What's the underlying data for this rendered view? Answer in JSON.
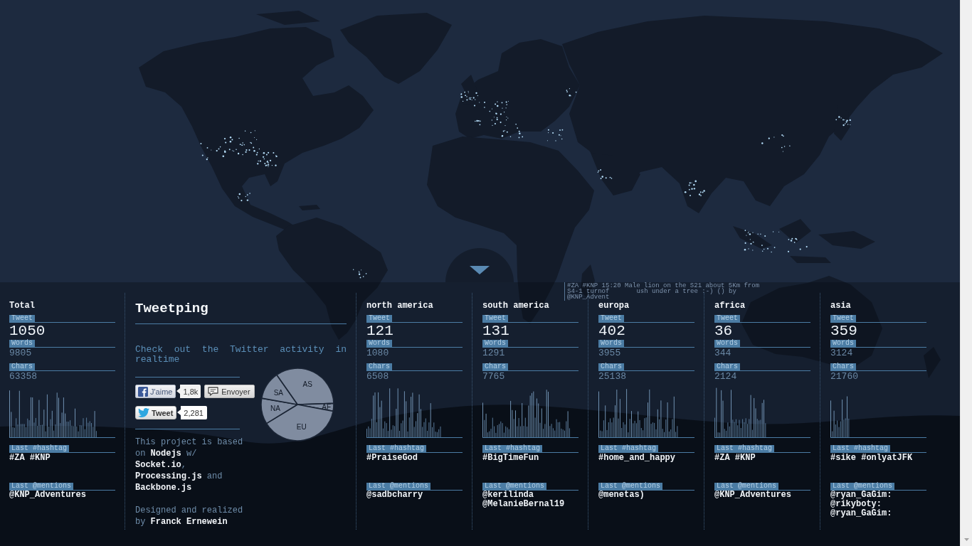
{
  "total": {
    "title": "Total",
    "stats": [
      {
        "kind": "primary",
        "label": "Tweet",
        "value": "1050"
      },
      {
        "kind": "secondary",
        "label": "Words",
        "value": "9805"
      },
      {
        "kind": "secondary",
        "label": "Chars",
        "value": "63358"
      }
    ],
    "hashtag": {
      "label": "Last #hashtag",
      "value": "#ZA #KNP"
    },
    "mentions": {
      "label": "Last @mentions",
      "value": "@KNP_Adventures"
    }
  },
  "about": {
    "title": "Tweetping",
    "tagline": "Check out the Twitter activity in realtime",
    "social_rows": [
      {
        "buttons": [
          {
            "kind": "like",
            "label": "J'aime",
            "count": "1,8k"
          },
          {
            "kind": "send",
            "label": "Envoyer"
          }
        ]
      },
      {
        "buttons": [
          {
            "kind": "tweet",
            "label": "Tweet",
            "count": "2,281"
          }
        ]
      }
    ],
    "credits": [
      "This project is based on **Nodejs** w/ **Socket.io**, **Processing.js** and **Backbone.js**",
      "Designed and realized by **Franck Ernewein**"
    ]
  },
  "regions": [
    {
      "code": "NA",
      "title": "north america",
      "stats": [
        {
          "kind": "primary",
          "label": "Tweet",
          "value": "121"
        },
        {
          "kind": "secondary",
          "label": "Words",
          "value": "1080"
        },
        {
          "kind": "secondary",
          "label": "Chars",
          "value": "6508"
        }
      ],
      "hashtag": {
        "label": "Last #hashtag",
        "value": "#PraiseGod"
      },
      "mentions": {
        "label": "Last @mentions",
        "value": "@sadbcharry"
      }
    },
    {
      "code": "SA",
      "title": "south america",
      "stats": [
        {
          "kind": "primary",
          "label": "Tweet",
          "value": "131"
        },
        {
          "kind": "secondary",
          "label": "Words",
          "value": "1291"
        },
        {
          "kind": "secondary",
          "label": "Chars",
          "value": "7765"
        }
      ],
      "hashtag": {
        "label": "Last #hashtag",
        "value": "#BigTimeFun"
      },
      "mentions": {
        "label": "Last @mentions",
        "value": "@kerilinda @MelanieBernal19"
      }
    },
    {
      "code": "EU",
      "title": "europa",
      "stats": [
        {
          "kind": "primary",
          "label": "Tweet",
          "value": "402"
        },
        {
          "kind": "secondary",
          "label": "Words",
          "value": "3955"
        },
        {
          "kind": "secondary",
          "label": "Chars",
          "value": "25138"
        }
      ],
      "hashtag": {
        "label": "Last #hashtag",
        "value": "#home_and_happy"
      },
      "mentions": {
        "label": "Last @mentions",
        "value": "@menetas)"
      }
    },
    {
      "code": "AF",
      "title": "africa",
      "stats": [
        {
          "kind": "primary",
          "label": "Tweet",
          "value": "36"
        },
        {
          "kind": "secondary",
          "label": "Words",
          "value": "344"
        },
        {
          "kind": "secondary",
          "label": "Chars",
          "value": "2124"
        }
      ],
      "hashtag": {
        "label": "Last #hashtag",
        "value": "#ZA #KNP"
      },
      "mentions": {
        "label": "Last @mentions",
        "value": "@KNP_Adventures"
      }
    },
    {
      "code": "AS",
      "title": "asia",
      "stats": [
        {
          "kind": "primary",
          "label": "Tweet",
          "value": "359"
        },
        {
          "kind": "secondary",
          "label": "Words",
          "value": "3124"
        },
        {
          "kind": "secondary",
          "label": "Chars",
          "value": "21760"
        }
      ],
      "hashtag": {
        "label": "Last #hashtag",
        "value": "#sike #onlyatJFK"
      },
      "mentions": {
        "label": "Last @mentions",
        "value": "@ryan_GaGim: @rikyboty: @ryan_GaGim:"
      }
    }
  ],
  "tooltip": {
    "lines": [
      {
        "parts": [
          "#ZA #KNP 15:20 Male lion on the S21 about 5Km from"
        ]
      },
      {
        "parts": [
          "S4-1 turnof",
          "ush under a tree :-) () by"
        ]
      },
      {
        "parts": [
          "@KNP_Advent"
        ]
      }
    ]
  }
}
